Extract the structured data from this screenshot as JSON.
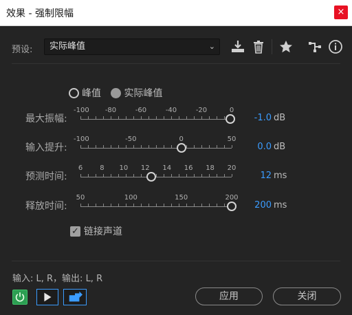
{
  "window": {
    "title": "效果 - 强制限幅",
    "close_glyph": "×"
  },
  "preset": {
    "label": "预设:",
    "value": "实际峰值",
    "icons": [
      "download-preset-icon",
      "delete-icon",
      "favorite-star-icon",
      "routing-icon",
      "info-icon"
    ]
  },
  "mode": {
    "options": [
      "峰值",
      "实际峰值"
    ],
    "selected": "实际峰值"
  },
  "sliders": [
    {
      "label": "最大振幅:",
      "ticks": [
        "-100",
        "-80",
        "-60",
        "-40",
        "-20",
        "0"
      ],
      "value": "-1.0",
      "unit": "dB",
      "level": -1.0,
      "min": -100,
      "max": 0
    },
    {
      "label": "输入提升:",
      "ticks": [
        "-100",
        "-50",
        "0",
        "50"
      ],
      "value": "0.0",
      "unit": "dB",
      "level": 0.0,
      "min": -100,
      "max": 50
    },
    {
      "label": "预测时间:",
      "ticks": [
        "6",
        "8",
        "10",
        "12",
        "14",
        "16",
        "18",
        "20"
      ],
      "value": "12",
      "unit": "ms",
      "level": 12,
      "min": 5,
      "max": 20
    },
    {
      "label": "释放时间:",
      "ticks": [
        "50",
        "100",
        "150",
        "200"
      ],
      "value": "200",
      "unit": "ms",
      "level": 200,
      "min": 25,
      "max": 200
    }
  ],
  "link_channels": {
    "label": "链接声道",
    "checked": true
  },
  "io": {
    "label": "输入: L, R，输出: L, R"
  },
  "buttons": {
    "apply": "应用",
    "close": "关闭"
  },
  "colors": {
    "accent": "#3b9cff",
    "power": "#2c9e52"
  }
}
